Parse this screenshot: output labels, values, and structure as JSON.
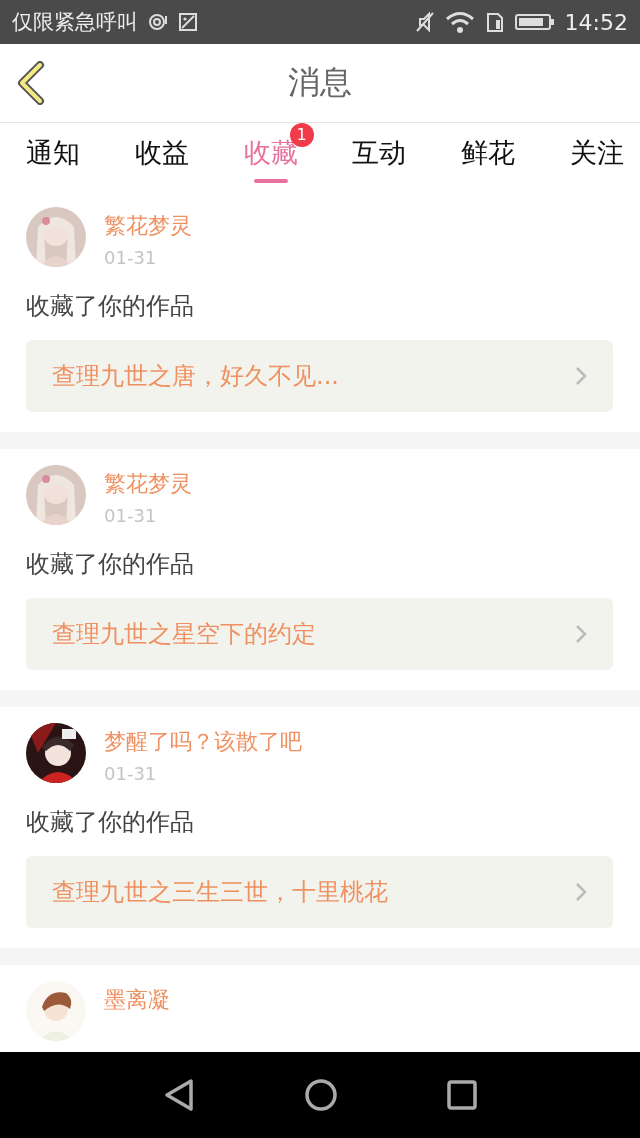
{
  "status_bar": {
    "carrier": "仅限紧急呼叫",
    "time": "14:52"
  },
  "header": {
    "title": "消息"
  },
  "tabs": [
    {
      "label": "通知",
      "selected": false
    },
    {
      "label": "收益",
      "selected": false
    },
    {
      "label": "收藏",
      "selected": true,
      "badge": "1"
    },
    {
      "label": "互动",
      "selected": false
    },
    {
      "label": "鲜花",
      "selected": false
    },
    {
      "label": "关注",
      "selected": false
    }
  ],
  "messages": [
    {
      "user": "繁花梦灵",
      "date": "01-31",
      "text": "收藏了你的作品",
      "work": "查理九世之唐，好久不见..."
    },
    {
      "user": "繁花梦灵",
      "date": "01-31",
      "text": "收藏了你的作品",
      "work": "查理九世之星空下的约定"
    },
    {
      "user": "梦醒了吗？该散了吧",
      "date": "01-31",
      "text": "收藏了你的作品",
      "work": "查理九世之三生三世，十里桃花"
    },
    {
      "user": "墨离凝"
    }
  ]
}
